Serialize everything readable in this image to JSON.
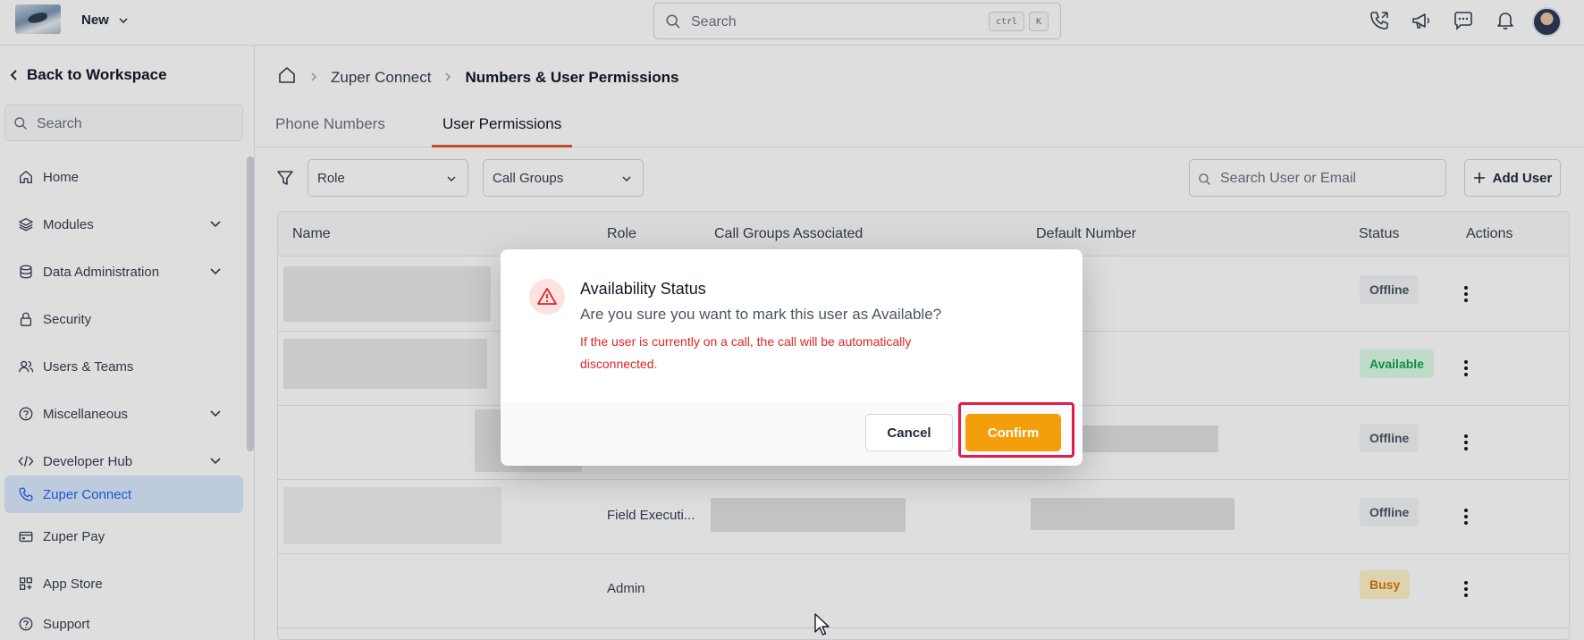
{
  "topbar": {
    "new_label": "New",
    "search_placeholder": "Search",
    "shortcut_key1": "ctrl",
    "shortcut_key2": "K",
    "icons": [
      "phone-icon",
      "megaphone-icon",
      "chat-icon",
      "bell-icon"
    ]
  },
  "sidebar": {
    "back_label": "Back to Workspace",
    "search_placeholder": "Search",
    "items": [
      {
        "label": "Home",
        "icon": "home-icon"
      },
      {
        "label": "Modules",
        "icon": "layers-icon",
        "expandable": true
      },
      {
        "label": "Data Administration",
        "icon": "database-icon",
        "expandable": true
      },
      {
        "label": "Security",
        "icon": "lock-icon"
      },
      {
        "label": "Users & Teams",
        "icon": "users-icon"
      },
      {
        "label": "Miscellaneous",
        "icon": "question-icon",
        "expandable": true
      },
      {
        "label": "Developer Hub",
        "icon": "code-icon",
        "expandable": true
      },
      {
        "label": "Zuper Connect",
        "icon": "phone-icon",
        "active": true
      },
      {
        "label": "Zuper Pay",
        "icon": "wallet-icon"
      },
      {
        "label": "App Store",
        "icon": "grid-icon"
      },
      {
        "label": "Support",
        "icon": "help-icon"
      }
    ]
  },
  "breadcrumb": {
    "parent": "Zuper Connect",
    "current": "Numbers & User Permissions"
  },
  "tabs": [
    {
      "label": "Phone Numbers",
      "active": false
    },
    {
      "label": "User Permissions",
      "active": true
    }
  ],
  "filters": {
    "role_label": "Role",
    "call_groups_label": "Call Groups",
    "user_search_placeholder": "Search User or Email",
    "add_user_label": "Add User"
  },
  "table": {
    "headers": [
      "Name",
      "Role",
      "Call Groups Associated",
      "Default Number",
      "Status",
      "Actions"
    ],
    "rows": [
      {
        "role": "",
        "status": "Offline",
        "status_type": "offline"
      },
      {
        "role": "",
        "status": "Available",
        "status_type": "available"
      },
      {
        "role": "",
        "status": "Offline",
        "status_type": "offline"
      },
      {
        "role": "Field Executi...",
        "status": "Offline",
        "status_type": "offline"
      },
      {
        "role": "Admin",
        "status": "Busy",
        "status_type": "busy"
      }
    ]
  },
  "modal": {
    "title": "Availability Status",
    "message": "Are you sure you want to mark this user as Available?",
    "warning": "If the user is currently on a call, the call will be automatically disconnected.",
    "cancel_label": "Cancel",
    "confirm_label": "Confirm"
  },
  "colors": {
    "accent": "#f59e0b",
    "active_tab_underline": "#e4572e",
    "warning_text": "#dc2626",
    "highlight_ring": "#e11d48",
    "active_nav_bg": "#dbeafe"
  }
}
